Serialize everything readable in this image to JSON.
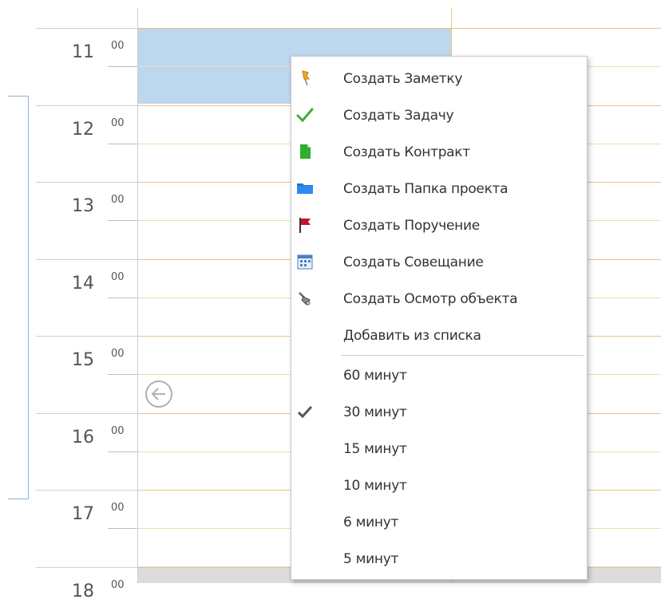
{
  "scheduler": {
    "hours": [
      {
        "h": "11",
        "m": "00"
      },
      {
        "h": "12",
        "m": "00"
      },
      {
        "h": "13",
        "m": "00"
      },
      {
        "h": "14",
        "m": "00"
      },
      {
        "h": "15",
        "m": "00"
      },
      {
        "h": "16",
        "m": "00"
      },
      {
        "h": "17",
        "m": "00"
      },
      {
        "h": "18",
        "m": "00"
      }
    ],
    "colors": {
      "selection": "#bcd7ee",
      "hour_line": "#e8c77a",
      "half_line": "#f3dfa8",
      "grid_gray": "#dcdcdc"
    }
  },
  "context_menu": {
    "create_items": [
      {
        "label": "Создать Заметку",
        "icon": "pushpin-icon"
      },
      {
        "label": "Создать Задачу",
        "icon": "checkmark-icon"
      },
      {
        "label": "Создать Контракт",
        "icon": "document-icon"
      },
      {
        "label": "Создать Папка проекта",
        "icon": "folder-icon"
      },
      {
        "label": "Создать Поручение",
        "icon": "flag-icon"
      },
      {
        "label": "Создать Совещание",
        "icon": "calendar-icon"
      },
      {
        "label": "Создать Осмотр объекта",
        "icon": "inspection-icon"
      }
    ],
    "add_from_list": "Добавить из списка",
    "durations": [
      {
        "label": "60 минут",
        "checked": false
      },
      {
        "label": "30 минут",
        "checked": true
      },
      {
        "label": "15 минут",
        "checked": false
      },
      {
        "label": "10 минут",
        "checked": false
      },
      {
        "label": "6 минут",
        "checked": false
      },
      {
        "label": "5 минут",
        "checked": false
      }
    ]
  }
}
